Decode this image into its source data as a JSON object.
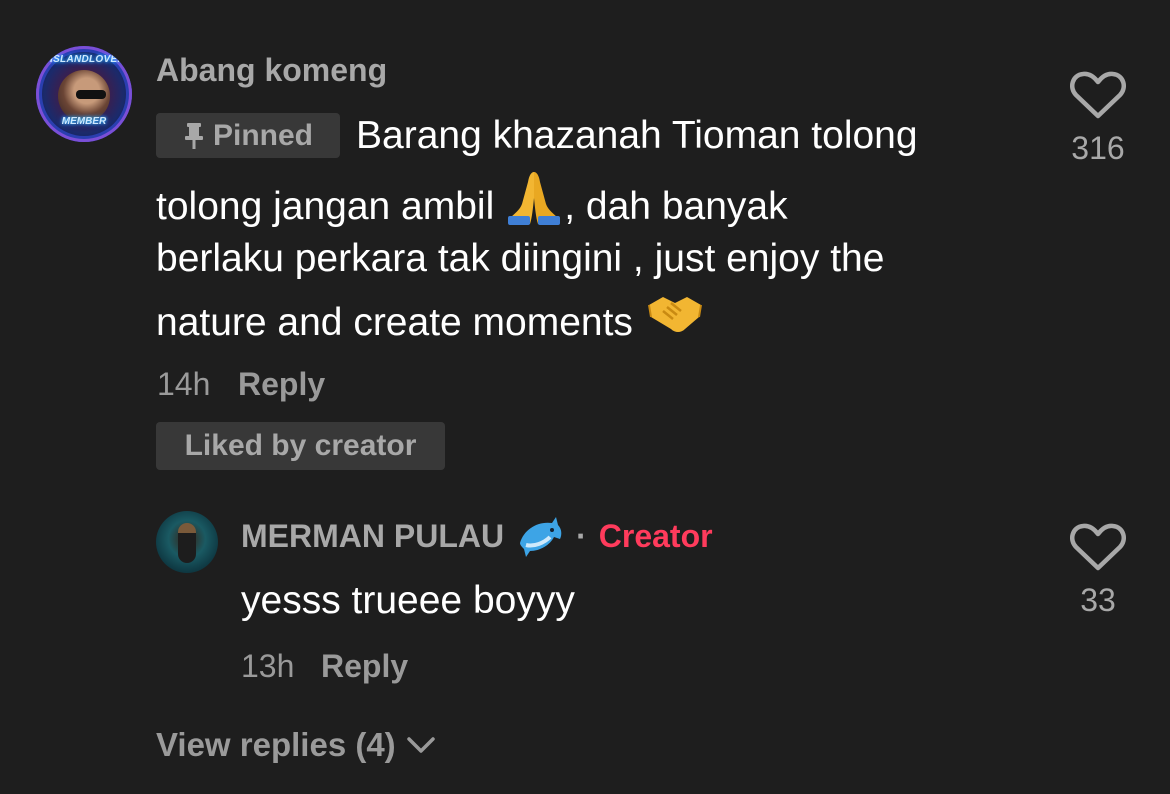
{
  "comment": {
    "username": "Abang komeng",
    "avatar_badge_top": "ISLANDLOVER",
    "avatar_badge_bottom": "MEMBER",
    "pinned_label": "Pinned",
    "text_line1": "Barang khazanah Tioman tolong",
    "text_line2a": "tolong jangan ambil",
    "text_line2b": ", dah banyak",
    "text_line3": "berlaku perkara tak diingini , just enjoy the",
    "text_line4": "nature and create moments",
    "time": "14h",
    "reply_label": "Reply",
    "liked_label": "Liked by creator",
    "like_count": "316",
    "emoji_1": "folded-hands",
    "emoji_2": "handshake"
  },
  "reply": {
    "username": "MERMAN PULAU",
    "username_emoji": "dolphin",
    "separator": "·",
    "creator_label": "Creator",
    "text": "yesss trueee boyyy",
    "time": "13h",
    "reply_label": "Reply",
    "like_count": "33"
  },
  "view_replies_label": "View replies (4)",
  "colors": {
    "background": "#1e1e1e",
    "creator_accent": "#ff3b5c",
    "secondary_text": "#a8a8a8",
    "tag_background": "#383838"
  }
}
